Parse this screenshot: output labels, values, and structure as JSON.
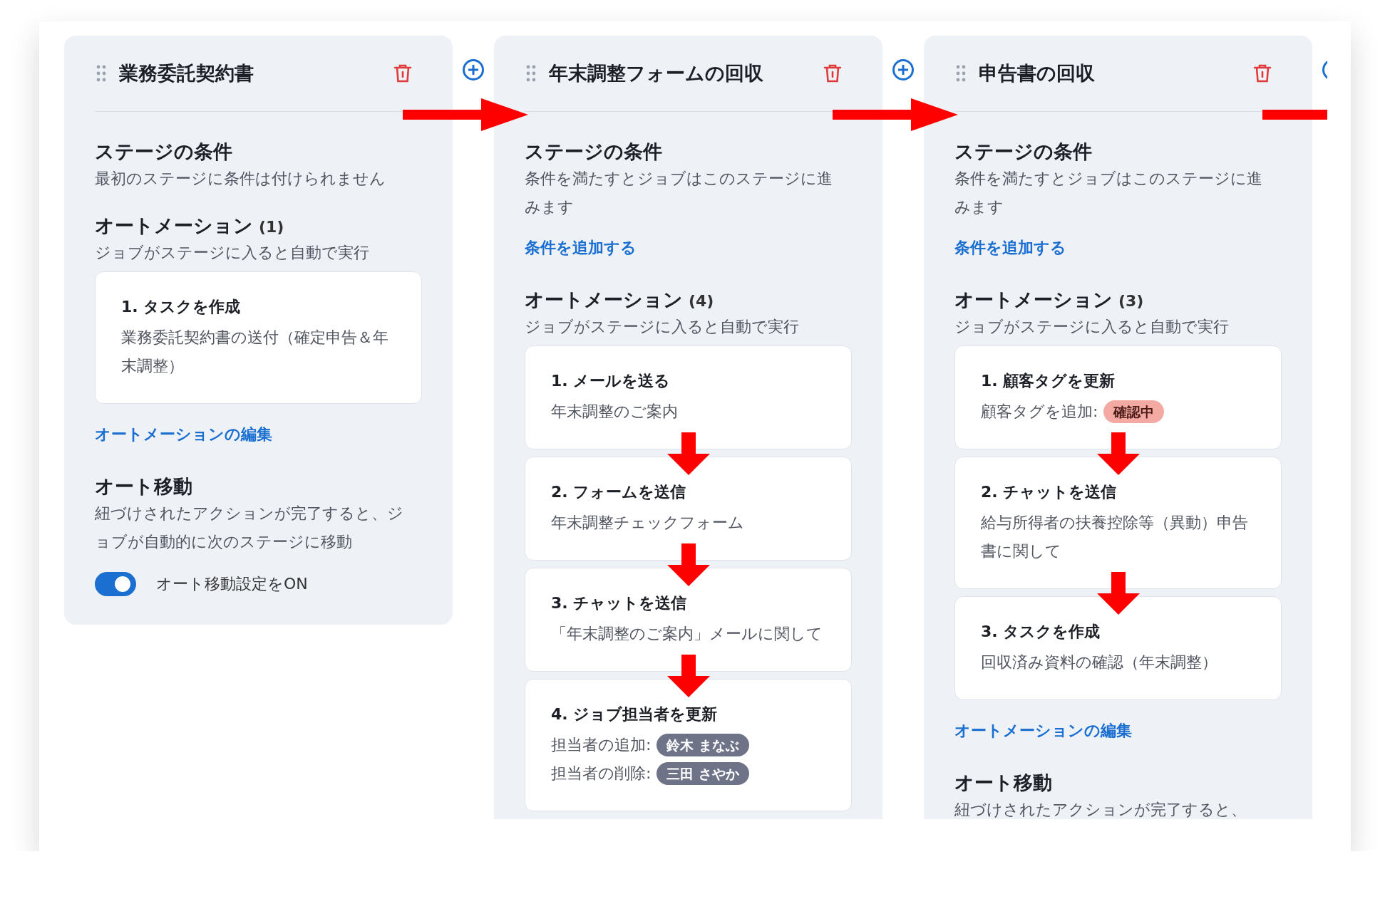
{
  "stages": [
    {
      "title": "業務委託契約書",
      "condition": {
        "heading": "ステージの条件",
        "description": "最初のステージに条件は付けられません"
      },
      "automation": {
        "heading": "オートメーション",
        "count": "(1)",
        "description": "ジョブがステージに入ると自動で実行",
        "items": [
          {
            "number": "1.",
            "title": "タスクを作成",
            "lines": [
              {
                "text": "業務委託契約書の送付（確定申告＆年末調整）"
              }
            ]
          }
        ],
        "edit_link": "オートメーションの編集"
      },
      "auto_move": {
        "heading": "オート移動",
        "description": "紐づけされたアクションが完了すると、ジョブが自動的に次のステージに移動",
        "toggle": {
          "label": "オート移動設定をON",
          "on": true
        }
      }
    },
    {
      "title": "年末調整フォームの回収",
      "condition": {
        "heading": "ステージの条件",
        "description": "条件を満たすとジョブはこのステージに進みます",
        "link": "条件を追加する"
      },
      "automation": {
        "heading": "オートメーション",
        "count": "(4)",
        "description": "ジョブがステージに入ると自動で実行",
        "items": [
          {
            "number": "1.",
            "title": "メールを送る",
            "lines": [
              {
                "text": "年末調整のご案内"
              }
            ]
          },
          {
            "number": "2.",
            "title": "フォームを送信",
            "lines": [
              {
                "text": "年末調整チェックフォーム"
              }
            ]
          },
          {
            "number": "3.",
            "title": "チャットを送信",
            "lines": [
              {
                "text": "「年末調整のご案内」メールに関して"
              }
            ]
          },
          {
            "number": "4.",
            "title": "ジョブ担当者を更新",
            "lines": [
              {
                "text": "担当者の追加:",
                "tag": {
                  "label": "鈴木 まなぶ",
                  "color": "#6e7388"
                }
              },
              {
                "text": "担当者の削除:",
                "tag": {
                  "label": "三田 さやか",
                  "color": "#6e7388"
                }
              }
            ]
          }
        ]
      }
    },
    {
      "title": "申告書の回収",
      "condition": {
        "heading": "ステージの条件",
        "description": "条件を満たすとジョブはこのステージに進みます",
        "link": "条件を追加する"
      },
      "automation": {
        "heading": "オートメーション",
        "count": "(3)",
        "description": "ジョブがステージに入ると自動で実行",
        "items": [
          {
            "number": "1.",
            "title": "顧客タグを更新",
            "lines": [
              {
                "text": "顧客タグを追加:",
                "tag": {
                  "label": "確認中",
                  "color": "#f4aaa2"
                }
              }
            ]
          },
          {
            "number": "2.",
            "title": "チャットを送信",
            "lines": [
              {
                "text": "給与所得者の扶養控除等（異動）申告書に関して"
              }
            ]
          },
          {
            "number": "3.",
            "title": "タスクを作成",
            "lines": [
              {
                "text": "回収済み資料の確認（年末調整）"
              }
            ]
          }
        ],
        "edit_link": "オートメーションの編集"
      },
      "auto_move": {
        "heading": "オート移動",
        "description": "紐づけされたアクションが完了すると、"
      }
    }
  ]
}
